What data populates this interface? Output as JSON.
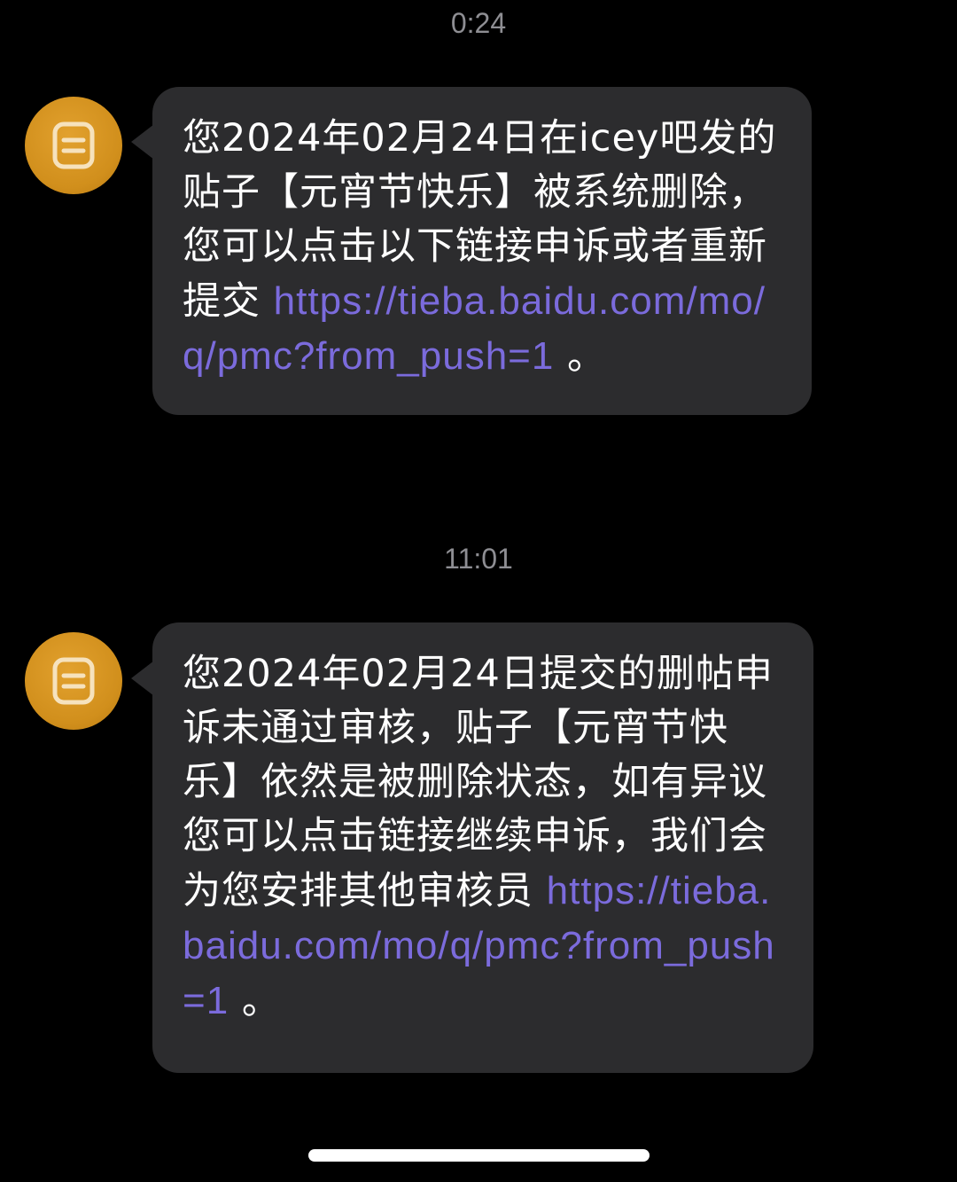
{
  "messages": [
    {
      "timestamp": "0:24",
      "text": "您2024年02月24日在icey吧发的贴子【元宵节快乐】被系统删除，您可以点击以下链接申诉或者重新提交",
      "link": "https://tieba.baidu.com/mo/q/pmc?from_push=1",
      "end": " 。",
      "avatar_icon": "document-icon"
    },
    {
      "timestamp": "11:01",
      "text": "您2024年02月24日提交的删帖申诉未通过审核，贴子【元宵节快乐】依然是被删除状态，如有异议您可以点击链接继续申诉，我们会为您安排其他审核员",
      "link": "https://tieba.baidu.com/mo/q/pmc?from_push=1",
      "end": " 。",
      "avatar_icon": "document-icon"
    }
  ],
  "colors": {
    "background": "#000000",
    "bubble": "#2c2c2e",
    "link": "#7b6bdc",
    "avatar": "#d18f1c",
    "timestamp": "#8e8e93"
  }
}
